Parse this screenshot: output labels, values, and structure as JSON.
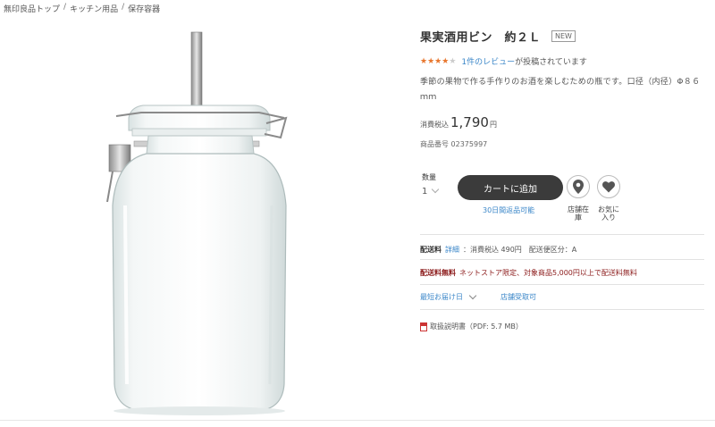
{
  "breadcrumb": [
    {
      "label": "無印良品トップ"
    },
    {
      "label": "キッチン用品"
    },
    {
      "label": "保存容器"
    }
  ],
  "breadcrumb_separator": "/",
  "product": {
    "title": "果実酒用ビン　約２Ｌ",
    "badge": "NEW",
    "rating": 4,
    "rating_max": 5,
    "review_link": "1件のレビュー",
    "review_suffix": "が投稿されています",
    "description": "季節の果物で作る手作りのお酒を楽しむための瓶です。口径（内径）Φ８６ｍｍ",
    "price_label": "消費税込",
    "price": "1,790",
    "price_unit": "円",
    "product_number": "商品番号 02375997"
  },
  "purchase": {
    "quantity_label": "数量",
    "quantity_value": "1",
    "cart_button": "カートに追加",
    "returns_note": "30日間返品可能",
    "store_stock_caption": "店舗在庫",
    "favorite_caption": "お気に入り"
  },
  "shipping": {
    "fee_label": "配送料",
    "fee_detail_link": "詳細",
    "fee_text": "：消費税込 490円　配送便区分：A",
    "free_label": "配送料無料",
    "free_note": "ネットストア限定、対象商品5,000円以上で配送料無料",
    "earliest_delivery": "最短お届け日",
    "store_pickup": "店舗受取可",
    "manual": "取扱説明書（PDF: 5.7 MB）"
  },
  "colors": {
    "accent_link": "#3a86c8",
    "star": "#e8762d",
    "star_empty": "#cccccc",
    "free_shipping": "#8b1a1a",
    "cart_button": "#3b3b3b"
  },
  "icons": {
    "store_icon": "map-pin-icon",
    "favorite_icon": "heart-icon",
    "manual_icon": "pdf-icon"
  }
}
